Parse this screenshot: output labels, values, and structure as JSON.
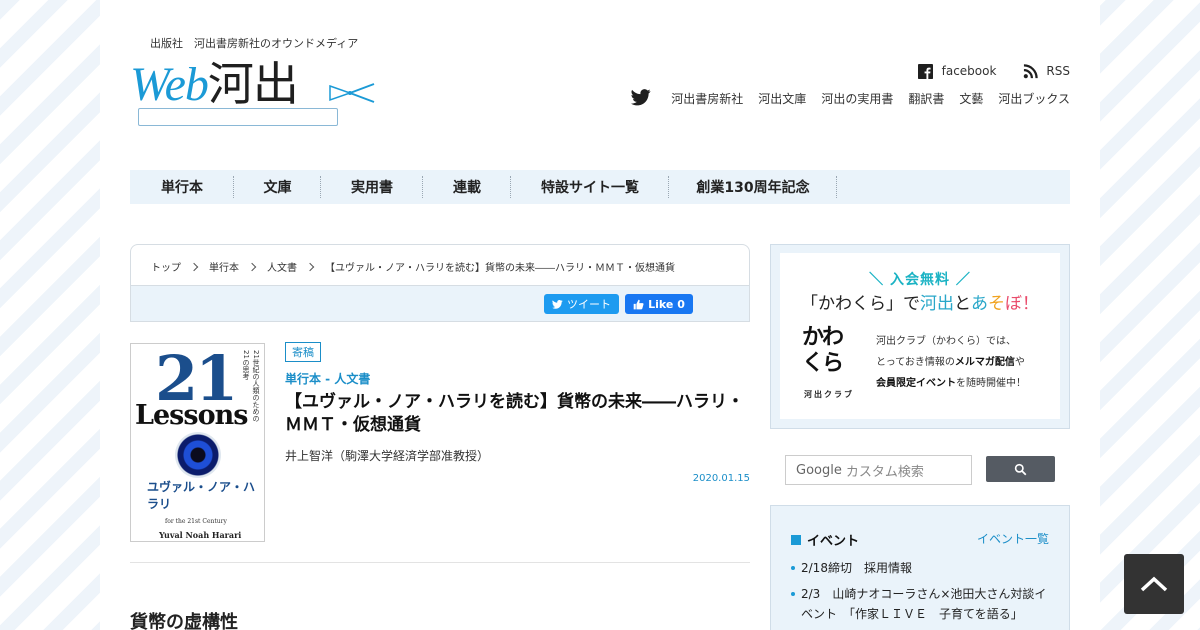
{
  "header": {
    "tagline": "出版社　河出書房新社のオウンドメディア",
    "logo_text_latin": "Web",
    "logo_text_kanji": "河出",
    "social": {
      "facebook": "facebook",
      "rss": "RSS"
    },
    "top_links": [
      "河出書房新社",
      "河出文庫",
      "河出の実用書",
      "翻訳書",
      "文藝",
      "河出ブックス"
    ]
  },
  "nav": {
    "items": [
      "単行本",
      "文庫",
      "実用書",
      "連載",
      "特設サイト一覧",
      "創業130周年記念"
    ]
  },
  "breadcrumb": [
    "トップ",
    "単行本",
    "人文書",
    "【ユヴァル・ノア・ハラリを読む】貨幣の未来――ハラリ・ＭＭＴ・仮想通貨"
  ],
  "share": {
    "tweet": "ツイート",
    "like": "Like 0"
  },
  "article": {
    "tag": "寄稿",
    "category": "単行本 - 人文書",
    "title": "【ユヴァル・ノア・ハラリを読む】貨幣の未来――ハラリ・ＭＭＴ・仮想通貨",
    "author": "井上智洋（駒澤大学経済学部准教授）",
    "date": "2020.01.15",
    "section_heading": "貨幣の虚構性",
    "cover": {
      "number": "21",
      "word": "Lessons",
      "author_jp": "ユヴァル・ノア・ハラリ",
      "subtitle": "for the 21st Century",
      "author_en": "Yuval Noah Harari",
      "vertical_1": "21世紀の人類のための",
      "vertical_2": "21の思考"
    }
  },
  "sidebar": {
    "promo": {
      "free": "＼ 入会無料 ／",
      "head_1": "「かわくら」で",
      "head_2": "河出",
      "head_3": "と",
      "head_4": "あ",
      "head_5": "そ",
      "head_6": "ぼ",
      "head_7": "！",
      "logo_mark": "かわくら",
      "logo_sub": "河出クラブ",
      "line1": "河出クラブ（かわくら）では、",
      "line2_a": "とっておき情報の",
      "line2_b": "メルマガ配信",
      "line2_c": "や",
      "line3_a": "会員限定イベント",
      "line3_b": "を随時開催中！"
    },
    "search": {
      "placeholder": "カスタム検索",
      "brand": "Google"
    },
    "events": {
      "title": "イベント",
      "all_link": "イベント一覧",
      "items": [
        "2/18締切　採用情報",
        "2/3　山崎ナオコーラさん×池田大さん対談イベント　「作家ＬＩＶＥ　子育てを語る」"
      ]
    }
  },
  "colors": {
    "accent": "#1b8ec8",
    "nav_bg": "#eaf3fa",
    "tweet": "#1d9bf0",
    "like": "#1877f2"
  }
}
